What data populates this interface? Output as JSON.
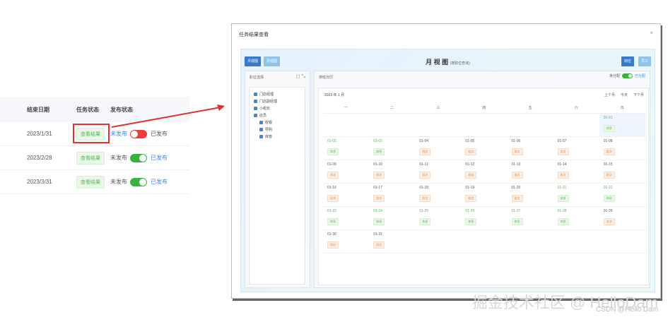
{
  "table": {
    "headers": [
      "结束日期",
      "任务状态",
      "发布状态"
    ],
    "rows": [
      {
        "date": "2023/1/31",
        "view": "查看结果",
        "unpublished": "未发布",
        "published": "已发布",
        "toggle_on": false
      },
      {
        "date": "2023/2/28",
        "view": "查看结果",
        "unpublished": "未发布",
        "published": "已发布",
        "toggle_on": true
      },
      {
        "date": "2023/3/31",
        "view": "查看结果",
        "unpublished": "未发布",
        "published": "已发布",
        "toggle_on": true
      }
    ]
  },
  "dialog": {
    "title": "任务结果查看",
    "close": "×",
    "toolbar": {
      "btn_month": "月视图",
      "btn_week": "周视图",
      "title": "月 视 图",
      "subtitle": "(按职位查询)",
      "btn_right1": "岗位",
      "btn_right2": "员工"
    },
    "side": {
      "heading": "职位选择",
      "icons": "◻ ⤡",
      "items": [
        {
          "label": "门店经理",
          "indent": 0
        },
        {
          "label": "门店副经理",
          "indent": 0
        },
        {
          "label": "小组长",
          "indent": 0
        },
        {
          "label": "店员",
          "indent": 0
        },
        {
          "label": "收银",
          "indent": 1
        },
        {
          "label": "导购",
          "indent": 1
        },
        {
          "label": "库管",
          "indent": 1
        }
      ]
    },
    "main": {
      "heading": "排班日历",
      "toggle_left": "未分配",
      "toggle_right": "已分配"
    },
    "calendar": {
      "month_label": "2023 年 1 月",
      "nav": [
        "上个月",
        "今天",
        "下个月"
      ],
      "weekdays": [
        "一",
        "二",
        "三",
        "四",
        "五",
        "六",
        "日"
      ],
      "weeks": [
        [
          null,
          null,
          null,
          null,
          null,
          null,
          {
            "d": "01-01",
            "t": "休息",
            "today": true
          }
        ],
        [
          {
            "d": "01-02",
            "t": "休息"
          },
          {
            "d": "01-03",
            "t": "休息"
          },
          {
            "d": "01-04",
            "t": "班次"
          },
          {
            "d": "01-05",
            "t": "班次"
          },
          {
            "d": "01-06",
            "t": "班次"
          },
          {
            "d": "01-07",
            "t": "班次"
          },
          {
            "d": "01-08",
            "t": "班次"
          }
        ],
        [
          {
            "d": "01-09",
            "t": "班次"
          },
          {
            "d": "01-10",
            "t": "班次"
          },
          {
            "d": "01-11",
            "t": "班次"
          },
          {
            "d": "01-12",
            "t": "班次"
          },
          {
            "d": "01-13",
            "t": "班次"
          },
          {
            "d": "01-14",
            "t": "班次"
          },
          {
            "d": "01-15",
            "t": "班次"
          }
        ],
        [
          {
            "d": "01-16",
            "t": "班次"
          },
          {
            "d": "01-17",
            "t": "班次"
          },
          {
            "d": "01-18",
            "t": "班次"
          },
          {
            "d": "01-19",
            "t": "班次"
          },
          {
            "d": "01-20",
            "t": "班次"
          },
          {
            "d": "01-21",
            "t": "休息"
          },
          {
            "d": "01-22",
            "t": "休息"
          }
        ],
        [
          {
            "d": "01-23",
            "t": "休息"
          },
          {
            "d": "01-24",
            "t": "休息"
          },
          {
            "d": "01-25",
            "t": "休息"
          },
          {
            "d": "01-26",
            "t": "休息"
          },
          {
            "d": "01-27",
            "t": "休息"
          },
          {
            "d": "01-28",
            "t": "休息"
          },
          {
            "d": "01-29",
            "t": "班次"
          }
        ],
        [
          {
            "d": "01-30",
            "t": "班次"
          },
          {
            "d": "01-31",
            "t": "班次"
          },
          null,
          null,
          null,
          null,
          null
        ]
      ]
    }
  },
  "watermark": "掘金技术社区 @ HelloDam",
  "csdn": "CSDN @Hello Dam",
  "colors": {
    "accent": "#3d86e6",
    "green": "#38b23e",
    "red": "#e03030"
  }
}
